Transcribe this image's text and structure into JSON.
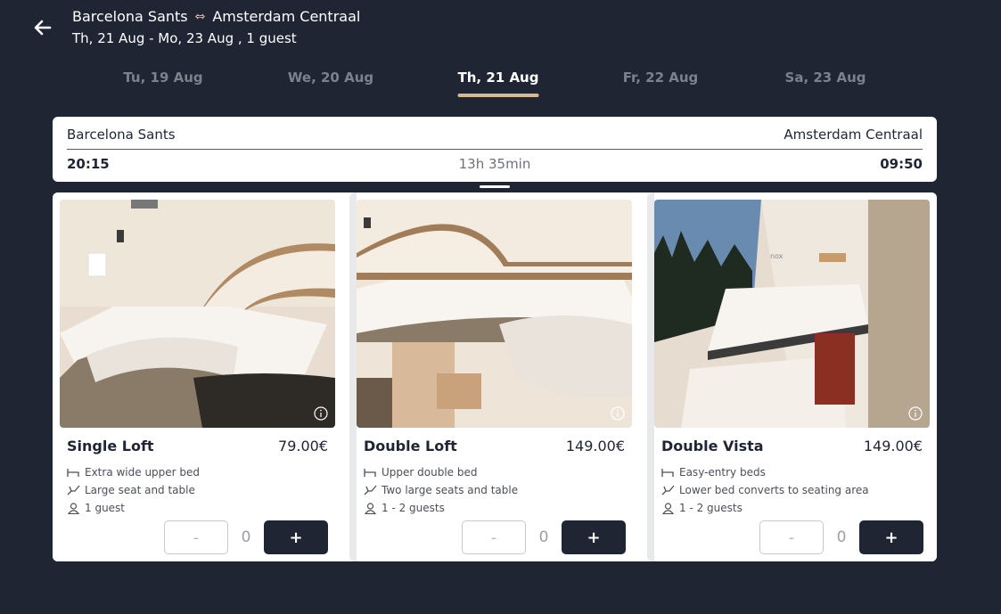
{
  "header": {
    "origin": "Barcelona Sants",
    "swap_icon": "swap-arrows-icon",
    "destination": "Amsterdam Centraal",
    "dates": "Th, 21 Aug - Mo, 23 Aug , 1 guest"
  },
  "date_tabs": [
    {
      "label": "Tu, 19 Aug",
      "active": false
    },
    {
      "label": "We, 20 Aug",
      "active": false
    },
    {
      "label": "Th, 21 Aug",
      "active": true
    },
    {
      "label": "Fr, 22 Aug",
      "active": false
    },
    {
      "label": "Sa, 23 Aug",
      "active": false
    }
  ],
  "journey": {
    "from": "Barcelona Sants",
    "to": "Amsterdam Centraal",
    "departure": "20:15",
    "duration": "13h 35min",
    "arrival": "09:50"
  },
  "cabins": [
    {
      "title": "Single Loft",
      "price": "79.00€",
      "features": [
        "Extra wide upper bed",
        "Large seat and table",
        "1 guest"
      ],
      "quantity": "0",
      "minus": "-",
      "plus": "+"
    },
    {
      "title": "Double Loft",
      "price": "149.00€",
      "features": [
        "Upper double bed",
        "Two large seats and table",
        "1 - 2 guests"
      ],
      "quantity": "0",
      "minus": "-",
      "plus": "+"
    },
    {
      "title": "Double Vista",
      "price": "149.00€",
      "features": [
        "Easy-entry beds",
        "Lower bed converts to seating area",
        "1 - 2 guests"
      ],
      "quantity": "0",
      "minus": "-",
      "plus": "+"
    }
  ],
  "colors": {
    "background": "#1f2532",
    "accent": "#d9b98c",
    "card": "#ffffff"
  }
}
